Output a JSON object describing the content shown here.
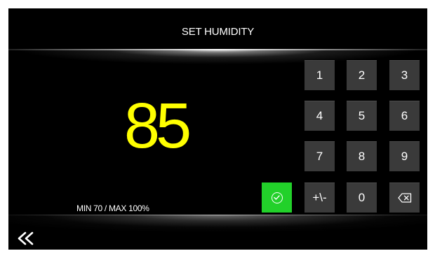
{
  "header": {
    "title": "SET HUMIDITY"
  },
  "display": {
    "value": "85",
    "value_color": "#ffff00",
    "limits": "MIN 70 / MAX 100%"
  },
  "keypad": {
    "keys": [
      "1",
      "2",
      "3",
      "4",
      "5",
      "6",
      "7",
      "8",
      "9",
      "+\\-",
      "0"
    ],
    "backspace_icon": "backspace-icon",
    "confirm_icon": "check-circle-icon",
    "confirm_color": "#22d12a",
    "key_color": "#3a3a3a"
  },
  "footer": {
    "back_icon": "double-chevron-left-icon"
  }
}
